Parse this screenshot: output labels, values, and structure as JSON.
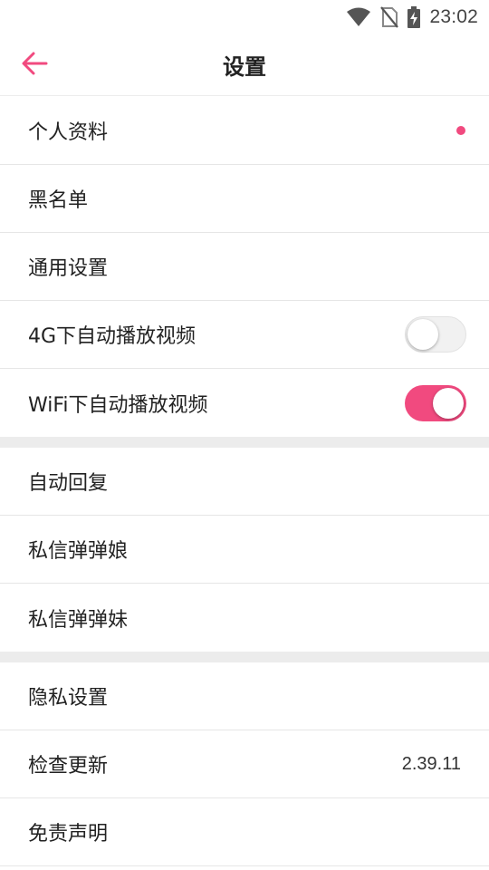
{
  "status_bar": {
    "time": "23:02",
    "icons": [
      "wifi-icon",
      "no-sim-icon",
      "battery-charging-icon"
    ]
  },
  "header": {
    "title": "设置",
    "back_icon": "arrow-left-icon"
  },
  "colors": {
    "accent": "#f14a7f",
    "divider": "#e6e6e6",
    "section_gap": "#ececec"
  },
  "sections": [
    {
      "items": [
        {
          "label": "个人资料",
          "badge": "red-dot"
        },
        {
          "label": "黑名单"
        },
        {
          "label": "通用设置"
        },
        {
          "label": "4G下自动播放视频",
          "toggle": "off"
        },
        {
          "label": "WiFi下自动播放视频",
          "toggle": "on"
        }
      ]
    },
    {
      "items": [
        {
          "label": "自动回复"
        },
        {
          "label": "私信弹弹娘"
        },
        {
          "label": "私信弹弹妹"
        }
      ]
    },
    {
      "items": [
        {
          "label": "隐私设置"
        },
        {
          "label": "检查更新",
          "value": "2.39.11"
        },
        {
          "label": "免责声明"
        }
      ]
    }
  ]
}
